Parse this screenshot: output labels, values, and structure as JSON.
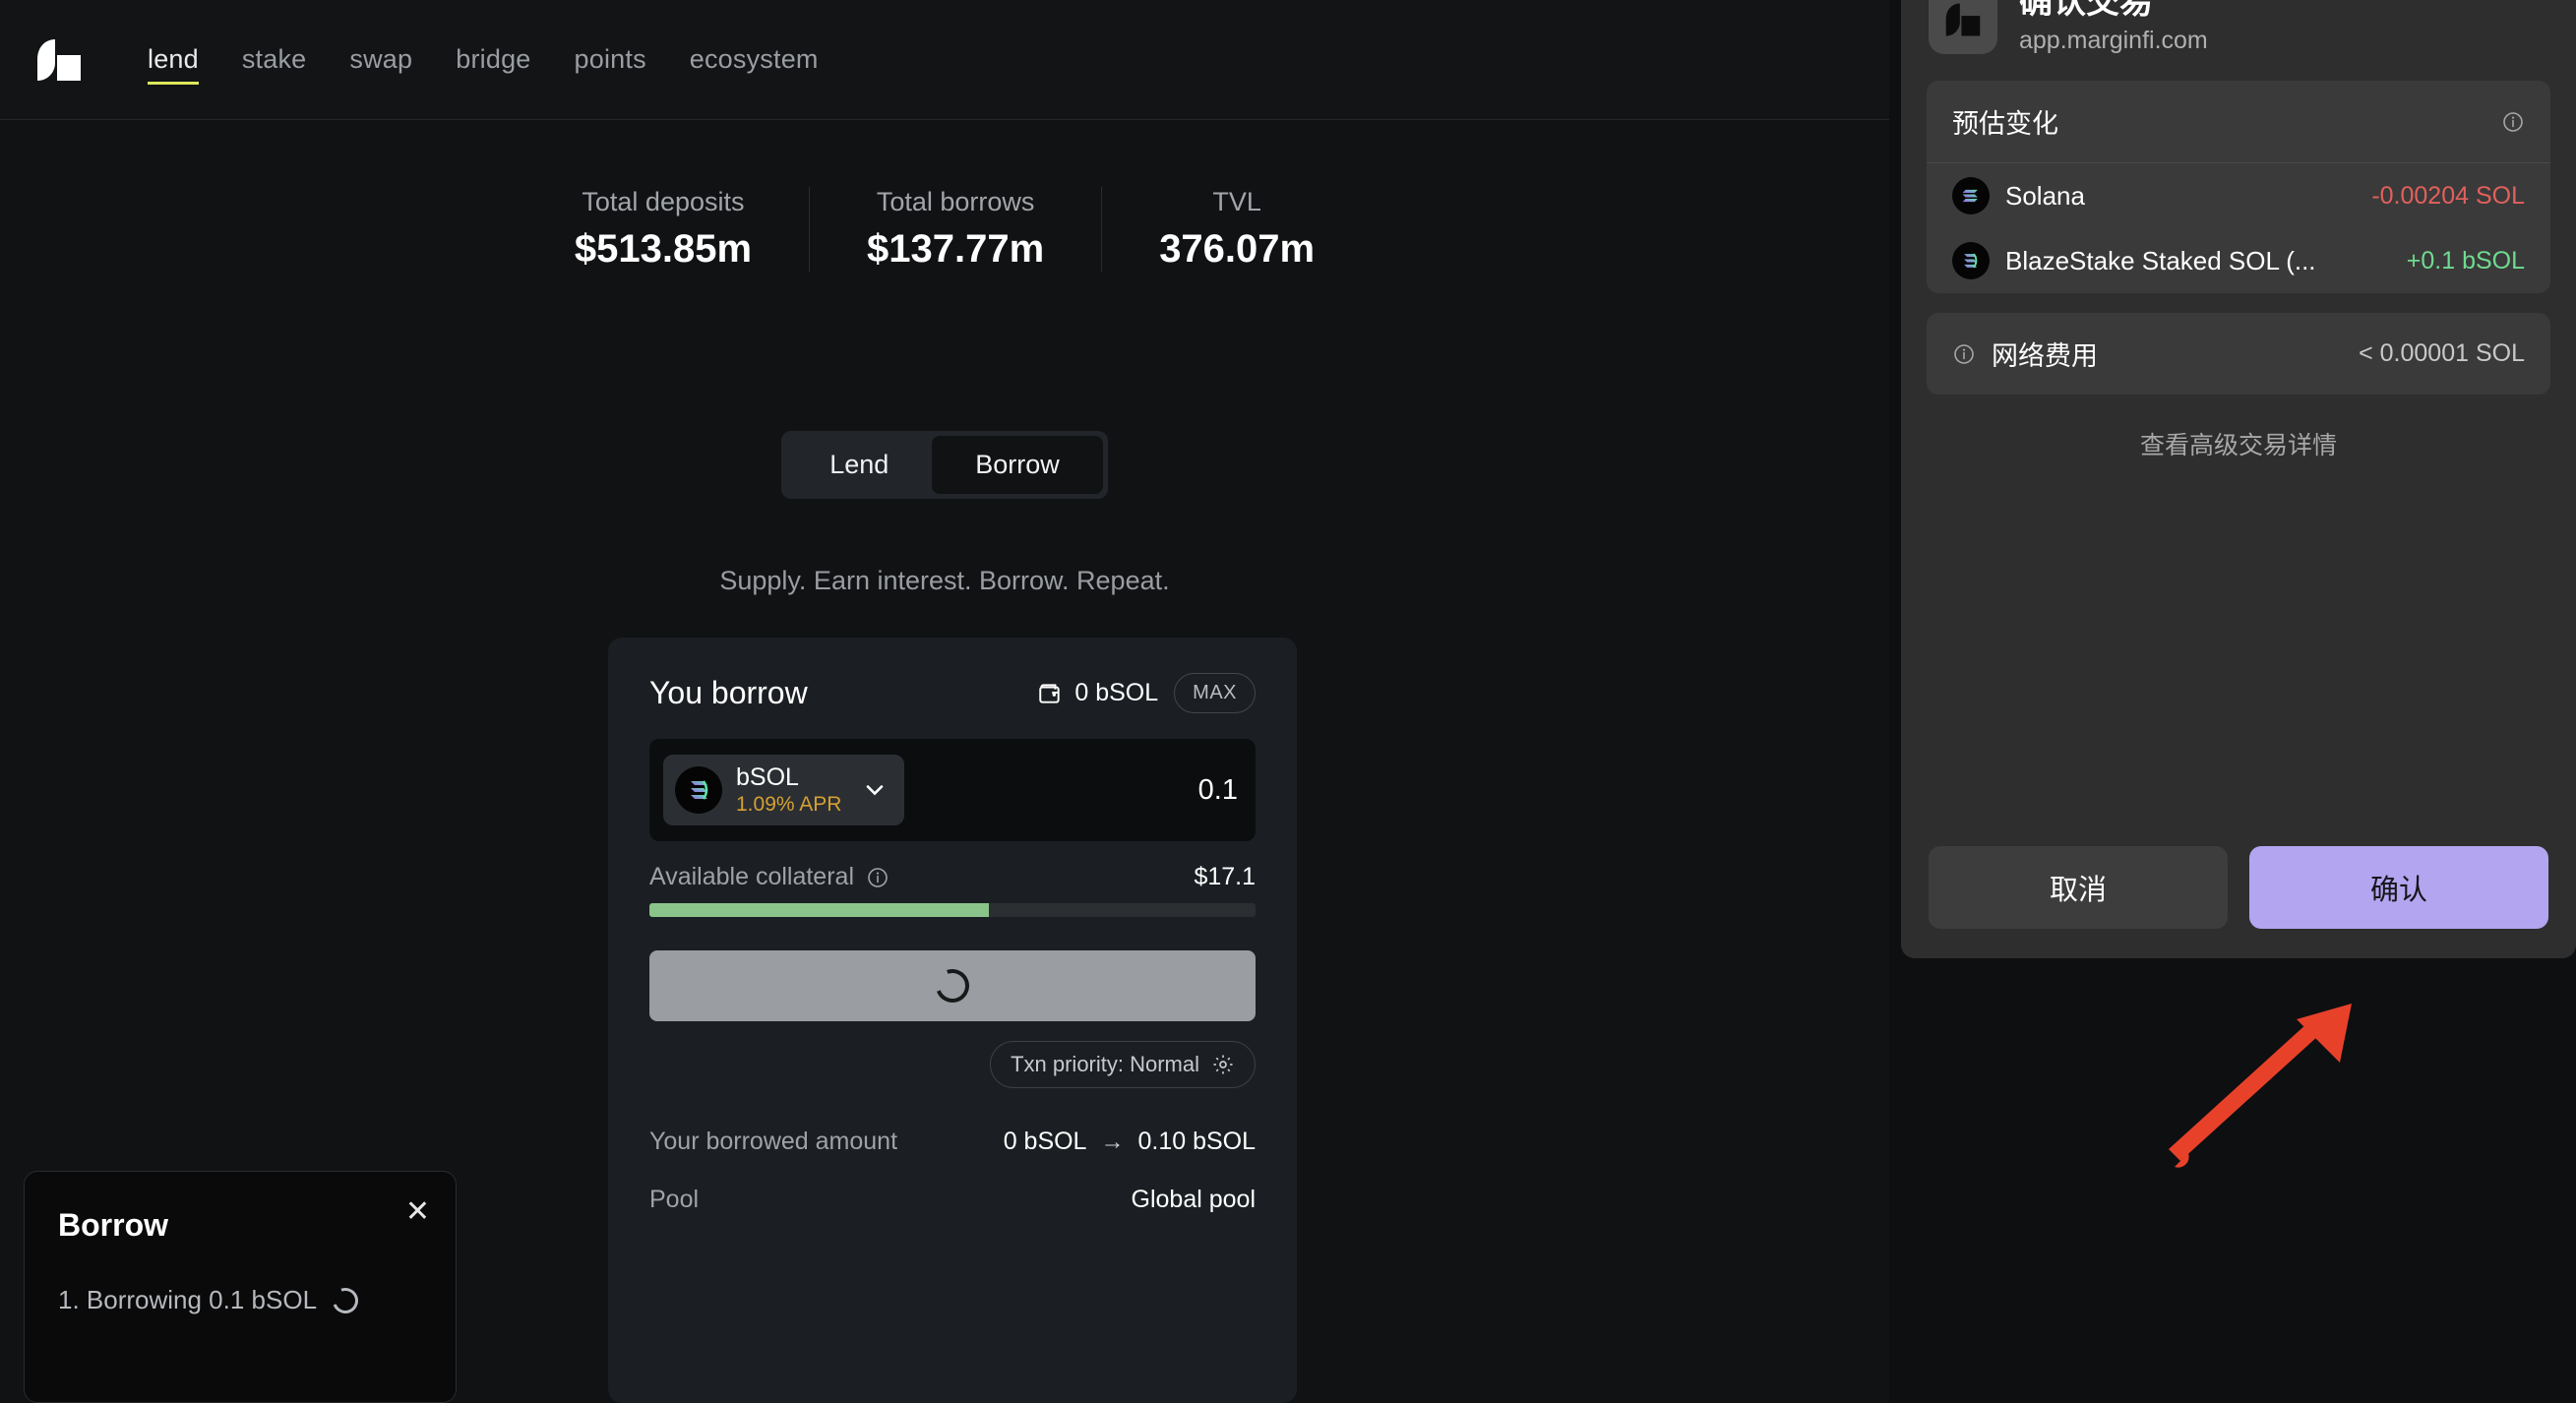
{
  "nav": {
    "logo_icon": "marginfi-logo",
    "links": [
      {
        "label": "lend",
        "active": true
      },
      {
        "label": "stake",
        "active": false
      },
      {
        "label": "swap",
        "active": false
      },
      {
        "label": "bridge",
        "active": false
      },
      {
        "label": "points",
        "active": false
      },
      {
        "label": "ecosystem",
        "active": false
      }
    ],
    "active_underline_color": "#dce85b"
  },
  "stats": [
    {
      "label": "Total deposits",
      "value": "$513.85m"
    },
    {
      "label": "Total borrows",
      "value": "$137.77m"
    },
    {
      "label": "TVL",
      "value": "376.07m"
    }
  ],
  "toggle": {
    "lend_label": "Lend",
    "borrow_label": "Borrow",
    "active": "Borrow"
  },
  "tagline": "Supply. Earn interest. Borrow. Repeat.",
  "borrow_card": {
    "title": "You borrow",
    "wallet_icon": "wallet-icon",
    "wallet_balance": "0 bSOL",
    "max_label": "MAX",
    "token": {
      "icon": "bsol-token-icon",
      "symbol": "bSOL",
      "apr": "1.09% APR",
      "apr_color": "#d5a033",
      "chevron_icon": "chevron-down-icon"
    },
    "amount_value": "0.1",
    "collateral": {
      "label": "Available collateral",
      "info_icon": "info-icon",
      "value": "$17.1",
      "fill_percent": 56,
      "fill_color": "#8bc48a"
    },
    "action_button": {
      "state": "loading",
      "icon": "spinner-icon"
    },
    "priority": {
      "label": "Txn priority: Normal",
      "gear_icon": "gear-icon"
    },
    "details": [
      {
        "label": "Your borrowed amount",
        "from": "0 bSOL",
        "arrow": "→",
        "to": "0.10 bSOL"
      },
      {
        "label": "Pool",
        "value": "Global pool"
      }
    ]
  },
  "toast": {
    "title": "Borrow",
    "close_icon": "close-icon",
    "step": "1. Borrowing 0.1 bSOL",
    "spinner_icon": "spinner-icon"
  },
  "wallet_panel": {
    "app_icon": "marginfi-app-icon",
    "title": "确认交易",
    "host": "app.marginfi.com",
    "estimate": {
      "heading": "预估变化",
      "info_icon": "info-icon",
      "rows": [
        {
          "icon": "solana-token-icon",
          "name": "Solana",
          "amount": "-0.00204 SOL",
          "sign": "negative",
          "color": "#e2605c"
        },
        {
          "icon": "bsol-token-icon",
          "name": "BlazeStake Staked SOL (...",
          "amount": "+0.1 bSOL",
          "sign": "positive",
          "color": "#6fdb8f"
        }
      ]
    },
    "fee": {
      "info_icon": "info-icon",
      "label": "网络费用",
      "value": "< 0.00001 SOL"
    },
    "advanced_link": "查看高级交易详情",
    "cancel_label": "取消",
    "confirm_label": "确认",
    "confirm_color": "#b3a5f0"
  },
  "annotation": {
    "arrow_icon": "red-arrow-pointing-to-confirm-button",
    "color": "#e8412a"
  }
}
